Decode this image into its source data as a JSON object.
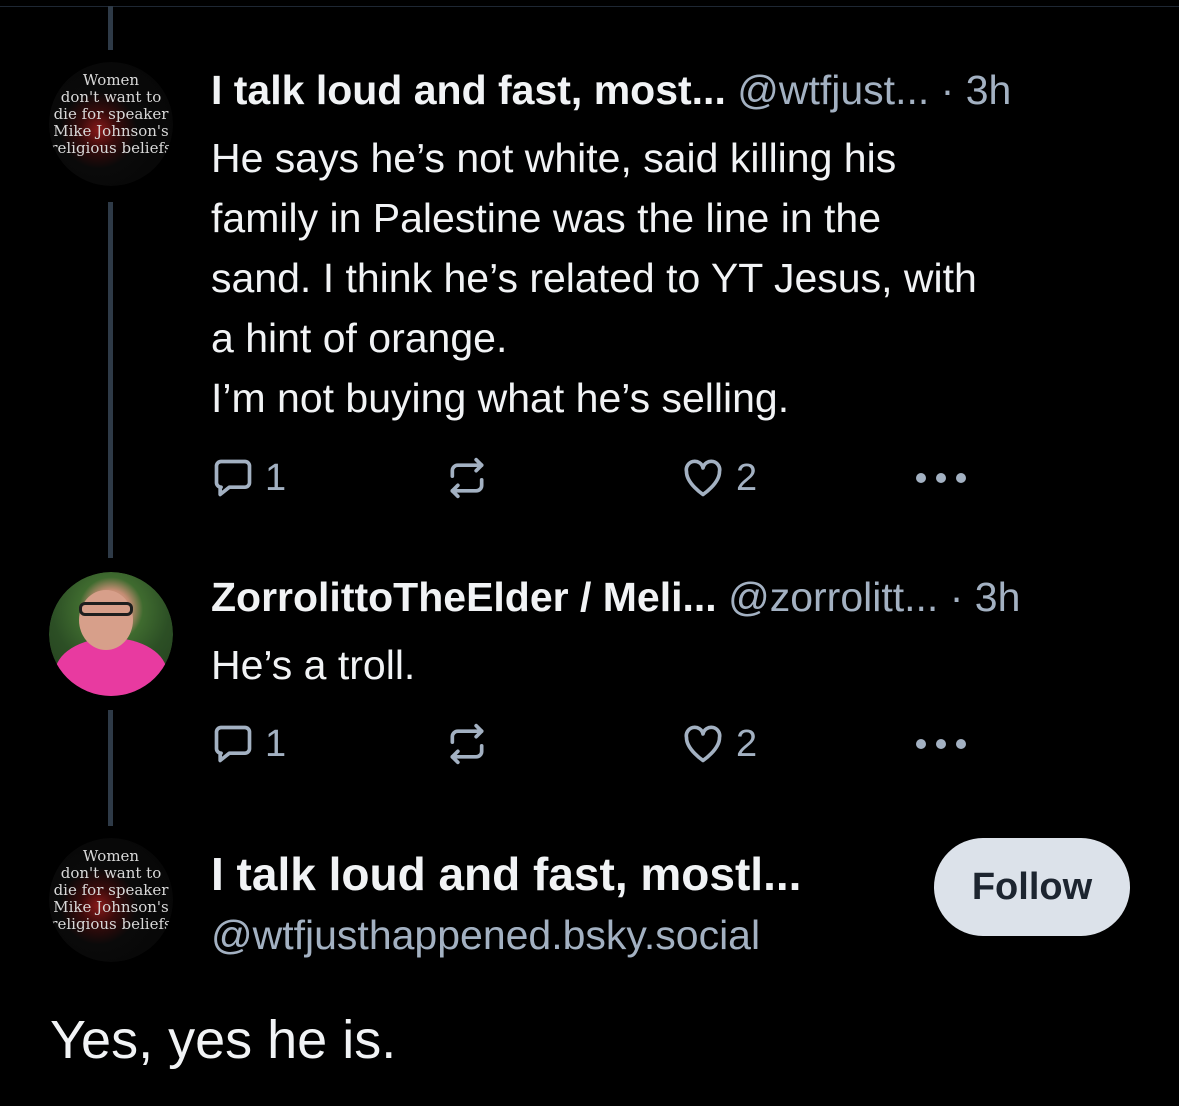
{
  "posts": [
    {
      "author_name": "I talk loud and fast, most...",
      "handle": "@wtfjust...",
      "time": "· 3h",
      "avatar_text": [
        "Women",
        "don't want to",
        "die for speaker",
        "Mike Johnson's",
        "religious beliefs"
      ],
      "text": "He says he’s not white, said killing his\nfamily in Palestine was the line in the\nsand. I think he’s related to YT Jesus, with\na hint of orange.\nI’m not buying what he’s selling.",
      "replies": "1",
      "likes": "2"
    },
    {
      "author_name": "ZorrolittoTheElder / Meli...",
      "handle": "@zorrolitt...",
      "time": "· 3h",
      "text": "He’s a troll.",
      "replies": "1",
      "likes": "2"
    }
  ],
  "main_post": {
    "author_name": "I talk loud and fast, mostl...",
    "handle": "@wtfjusthappened.bsky.social",
    "avatar_text": [
      "Women",
      "don't want to",
      "die for speaker",
      "Mike Johnson's",
      "religious beliefs"
    ],
    "follow_label": "Follow",
    "text": "Yes, yes he is."
  },
  "icons": {
    "reply": "speech-bubble-icon",
    "repost": "repost-arrows-icon",
    "like": "heart-icon",
    "more": "ellipsis-icon"
  },
  "colors": {
    "background": "#000000",
    "text_primary": "#f1f3f5",
    "text_secondary": "#a3b1c2",
    "thread_line": "#2e3a47",
    "follow_button_bg": "#dce2ea"
  }
}
